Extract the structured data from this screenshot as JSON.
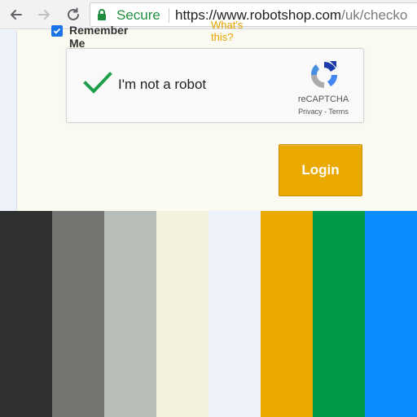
{
  "browser": {
    "security_label": "Secure",
    "url_main": "https://www.robotshop.com",
    "url_rest": "/uk/checko"
  },
  "form": {
    "remember_label": "Remember Me",
    "whats_this": "What's this?",
    "recaptcha": {
      "checkbox_label": "I'm not a robot",
      "brand": "reCAPTCHA",
      "links": "Privacy - Terms"
    },
    "login_label": "Login"
  },
  "colors": {
    "accent_orange": "#eaa900",
    "secure_green": "#1e8e3e",
    "checkmark_green": "#1e9e4a"
  },
  "palette": [
    {
      "color": "#2f3030"
    },
    {
      "color": "#767572"
    },
    {
      "color": "#b8bfb8"
    },
    {
      "color": "#f2f2de"
    },
    {
      "color": "#eef2fa"
    },
    {
      "color": "#eaaa00"
    },
    {
      "color": "#009b48"
    },
    {
      "color": "#0a8dff"
    }
  ],
  "icons": {
    "back": "back-arrow-icon",
    "forward": "forward-arrow-icon",
    "reload": "reload-icon",
    "lock": "lock-icon",
    "check": "checkmark-icon",
    "recaptcha_logo": "recaptcha-logo-icon"
  }
}
